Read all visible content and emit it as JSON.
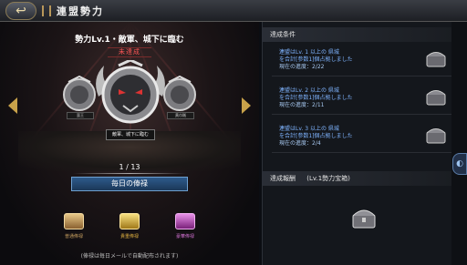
{
  "header": {
    "title": "連盟勢力",
    "back_icon": "back-arrow-icon"
  },
  "stage": {
    "name": "勢力Lv.1・敵軍、城下に臨む",
    "status": "未達成",
    "main_label": "敵軍、城下に臨む",
    "side_left_label": "蛮王",
    "side_right_label": "黄巾賊",
    "page": "1 / 13",
    "daily_button": "毎日の俸禄",
    "chests": [
      {
        "label": "普通俸禄",
        "color": "#c8a060"
      },
      {
        "label": "貴重俸禄",
        "color": "#e0b040"
      },
      {
        "label": "豪華俸禄",
        "color": "#c050c0"
      }
    ],
    "note": "(俸禄は毎日メールで自動配布されます)"
  },
  "conditions": {
    "header": "達成条件",
    "items": [
      {
        "line1": "連盟はLv. 1 以上の 県城",
        "line2": "を合計[参数1]個占拠しました",
        "progress": "現在の進度：2/22"
      },
      {
        "line1": "連盟はLv. 2 以上の 県城",
        "line2": "を合計[参数1]個占拠しました",
        "progress": "現在の進度：2/11"
      },
      {
        "line1": "連盟はLv. 3 以上の 県城",
        "line2": "を合計[参数1]個占拠しました",
        "progress": "現在の進度：2/4"
      }
    ]
  },
  "reward": {
    "header": "達成報酬",
    "name": "(Lv.1勢力宝箱)"
  },
  "colors": {
    "accent_blue": "#7fb4ff",
    "warning_red": "#ff5656",
    "gold": "#b8975a"
  }
}
